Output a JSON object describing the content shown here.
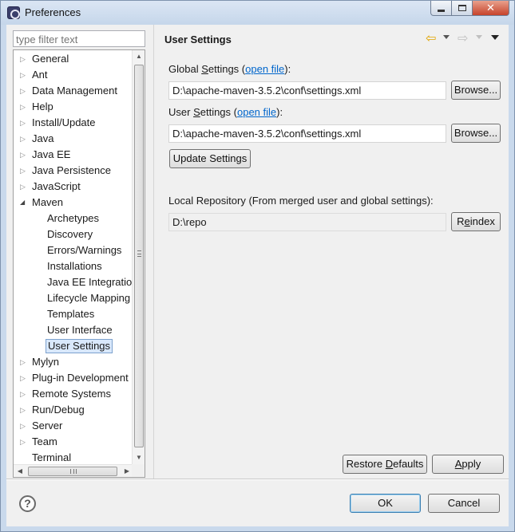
{
  "window": {
    "title": "Preferences"
  },
  "filter": {
    "placeholder": "type filter text"
  },
  "tree": {
    "items": [
      {
        "label": "General",
        "level": 0,
        "expand": "collapsed"
      },
      {
        "label": "Ant",
        "level": 0,
        "expand": "collapsed"
      },
      {
        "label": "Data Management",
        "level": 0,
        "expand": "collapsed"
      },
      {
        "label": "Help",
        "level": 0,
        "expand": "collapsed"
      },
      {
        "label": "Install/Update",
        "level": 0,
        "expand": "collapsed"
      },
      {
        "label": "Java",
        "level": 0,
        "expand": "collapsed"
      },
      {
        "label": "Java EE",
        "level": 0,
        "expand": "collapsed"
      },
      {
        "label": "Java Persistence",
        "level": 0,
        "expand": "collapsed"
      },
      {
        "label": "JavaScript",
        "level": 0,
        "expand": "collapsed"
      },
      {
        "label": "Maven",
        "level": 0,
        "expand": "expanded"
      },
      {
        "label": "Archetypes",
        "level": 1
      },
      {
        "label": "Discovery",
        "level": 1
      },
      {
        "label": "Errors/Warnings",
        "level": 1
      },
      {
        "label": "Installations",
        "level": 1
      },
      {
        "label": "Java EE Integration",
        "level": 1
      },
      {
        "label": "Lifecycle Mapping",
        "level": 1
      },
      {
        "label": "Templates",
        "level": 1
      },
      {
        "label": "User Interface",
        "level": 1
      },
      {
        "label": "User Settings",
        "level": 1,
        "selected": true
      },
      {
        "label": "Mylyn",
        "level": 0,
        "expand": "collapsed"
      },
      {
        "label": "Plug-in Development",
        "level": 0,
        "expand": "collapsed"
      },
      {
        "label": "Remote Systems",
        "level": 0,
        "expand": "collapsed"
      },
      {
        "label": "Run/Debug",
        "level": 0,
        "expand": "collapsed"
      },
      {
        "label": "Server",
        "level": 0,
        "expand": "collapsed"
      },
      {
        "label": "Team",
        "level": 0,
        "expand": "collapsed"
      },
      {
        "label": "Terminal",
        "level": 0,
        "expand": "none"
      }
    ]
  },
  "page": {
    "title": "User Settings",
    "global_settings": {
      "label_a": "Global ",
      "label_u": "S",
      "label_b": "ettings (",
      "link": "open file",
      "label_c": "):",
      "value": "D:\\apache-maven-3.5.2\\conf\\settings.xml",
      "browse": "Browse..."
    },
    "user_settings": {
      "label_a": "User ",
      "label_u": "S",
      "label_b": "ettings (",
      "link": "open file",
      "label_c": "):",
      "value": "D:\\apache-maven-3.5.2\\conf\\settings.xml",
      "browse": "Browse..."
    },
    "update_settings": "Update Settings",
    "local_repo": {
      "label": "Local Repository (From merged user and global settings):",
      "value": "D:\\repo",
      "reindex_a": "R",
      "reindex_u": "e",
      "reindex_b": "index"
    },
    "restore_defaults_a": "Restore ",
    "restore_defaults_u": "D",
    "restore_defaults_b": "efaults",
    "apply_u": "A",
    "apply_b": "pply"
  },
  "dialog": {
    "ok": "OK",
    "cancel": "Cancel",
    "help_glyph": "?"
  },
  "glyphs": {
    "collapsed": "▷",
    "expanded": "◢",
    "none": "",
    "scroll_up": "▲",
    "scroll_down": "▼",
    "scroll_left": "◀",
    "scroll_right": "▶",
    "back": "⇦",
    "forward": "⇨"
  },
  "colors": {
    "selection": "#d9e8fb",
    "link": "#0066cc",
    "accent": "#3c7fb1"
  }
}
